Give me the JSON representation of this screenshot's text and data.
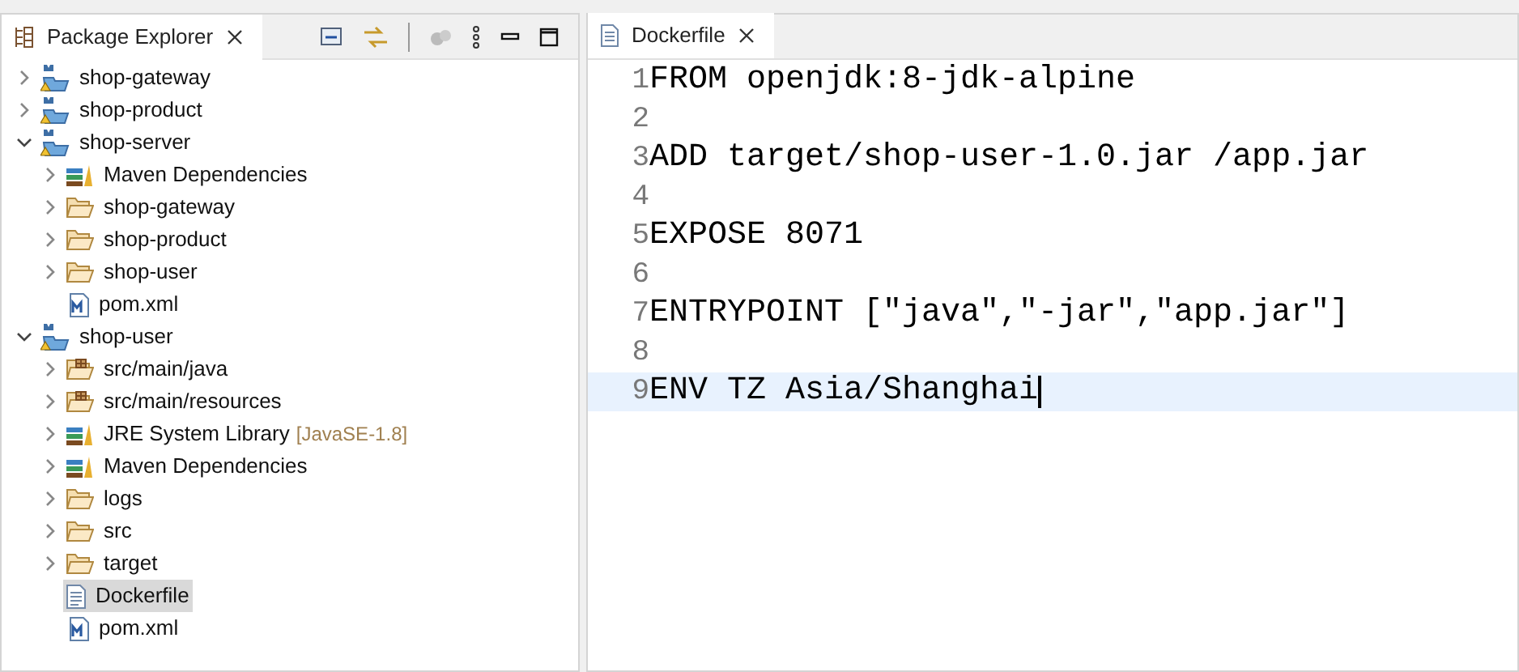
{
  "explorer": {
    "title": "Package Explorer",
    "tree": [
      {
        "label": "shop-gateway",
        "kind": "project",
        "expanded": false,
        "selected": false
      },
      {
        "label": "shop-product",
        "kind": "project",
        "expanded": false,
        "selected": false
      },
      {
        "label": "shop-server",
        "kind": "project",
        "expanded": true,
        "selected": false,
        "children": [
          {
            "label": "Maven Dependencies",
            "kind": "library",
            "expanded": false,
            "selected": false
          },
          {
            "label": "shop-gateway",
            "kind": "folder",
            "expanded": false,
            "selected": false
          },
          {
            "label": "shop-product",
            "kind": "folder",
            "expanded": false,
            "selected": false
          },
          {
            "label": "shop-user",
            "kind": "folder",
            "expanded": false,
            "selected": false
          },
          {
            "label": "pom.xml",
            "kind": "pom",
            "selected": false
          }
        ]
      },
      {
        "label": "shop-user",
        "kind": "project",
        "expanded": true,
        "selected": false,
        "children": [
          {
            "label": "src/main/java",
            "kind": "package",
            "expanded": false,
            "selected": false
          },
          {
            "label": "src/main/resources",
            "kind": "package",
            "expanded": false,
            "selected": false
          },
          {
            "label": "JRE System Library",
            "decoration": "[JavaSE-1.8]",
            "kind": "library",
            "expanded": false,
            "selected": false
          },
          {
            "label": "Maven Dependencies",
            "kind": "library",
            "expanded": false,
            "selected": false
          },
          {
            "label": "logs",
            "kind": "folder",
            "expanded": false,
            "selected": false
          },
          {
            "label": "src",
            "kind": "folder",
            "expanded": false,
            "selected": false
          },
          {
            "label": "target",
            "kind": "folder",
            "expanded": false,
            "selected": false
          },
          {
            "label": "Dockerfile",
            "kind": "file",
            "selected": true
          },
          {
            "label": "pom.xml",
            "kind": "pom",
            "selected": false
          }
        ]
      }
    ]
  },
  "editor": {
    "tab": "Dockerfile",
    "lines": [
      {
        "number": "1",
        "text": "FROM openjdk:8-jdk-alpine",
        "current": false
      },
      {
        "number": "2",
        "current": false
      },
      {
        "number": "3",
        "text": "ADD target/shop-user-1.0.jar /app.jar",
        "current": false
      },
      {
        "number": "4",
        "current": false
      },
      {
        "number": "5",
        "text": "EXPOSE 8071",
        "current": false
      },
      {
        "number": "6",
        "current": false
      },
      {
        "number": "7",
        "text": "ENTRYPOINT [\"java\",\"-jar\",\"app.jar\"]",
        "current": false
      },
      {
        "number": "8",
        "current": false
      },
      {
        "number": "9",
        "text": "ENV TZ Asia/Shanghai",
        "current": true
      }
    ]
  }
}
